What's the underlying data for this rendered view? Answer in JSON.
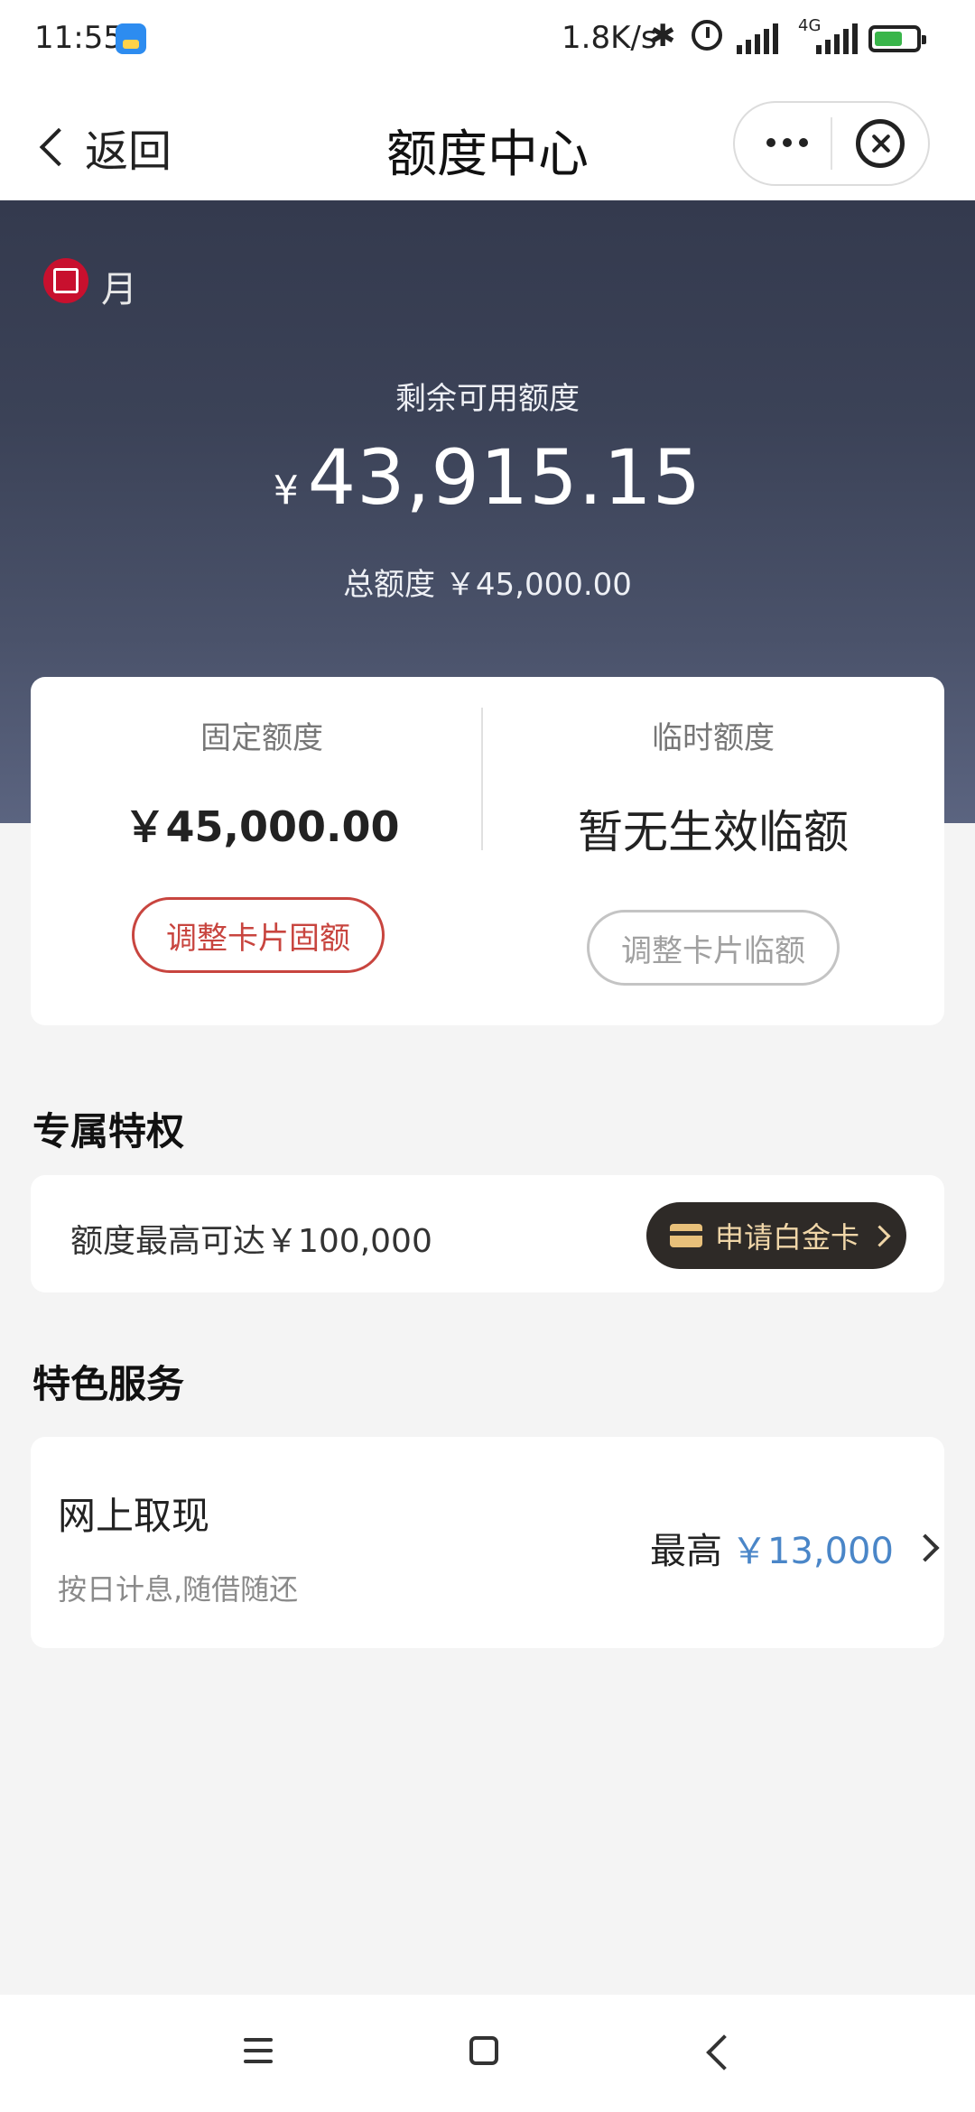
{
  "status_bar": {
    "time": "11:55",
    "net_speed": "1.8K/s",
    "network": "4G",
    "icons": [
      "app-notification-icon",
      "bluetooth-icon",
      "alarm-icon",
      "signal-icon",
      "battery-icon"
    ]
  },
  "nav": {
    "back_label": "返回",
    "title": "额度中心",
    "icons": [
      "chevron-left-icon",
      "more-icon",
      "close-icon"
    ]
  },
  "hero": {
    "logo_text": "月",
    "available_label": "剩余可用额度",
    "currency_symbol": "¥",
    "available_amount": "43,915.15",
    "total_label": "总额度 ￥45,000.00"
  },
  "limits": {
    "fixed_label": "固定额度",
    "fixed_value": "￥45,000.00",
    "temp_label": "临时额度",
    "temp_value": "暂无生效临额",
    "adjust_fixed_button": "调整卡片固额",
    "adjust_temp_button": "调整卡片临额"
  },
  "privileges": {
    "section_title": "专属特权",
    "text": "额度最高可达￥100,000",
    "apply_button": "申请白金卡"
  },
  "services": {
    "section_title": "特色服务",
    "items": [
      {
        "title": "网上取现",
        "subtitle": "按日计息,随借随还",
        "max_label": "最高",
        "max_amount": "￥13,000"
      }
    ]
  },
  "colors": {
    "hero_bg": "#3b4257",
    "accent_red": "#c8453f",
    "link_blue": "#4a86c8",
    "platinum_button_bg": "#2e2a27",
    "platinum_button_text": "#f0d6a8"
  }
}
